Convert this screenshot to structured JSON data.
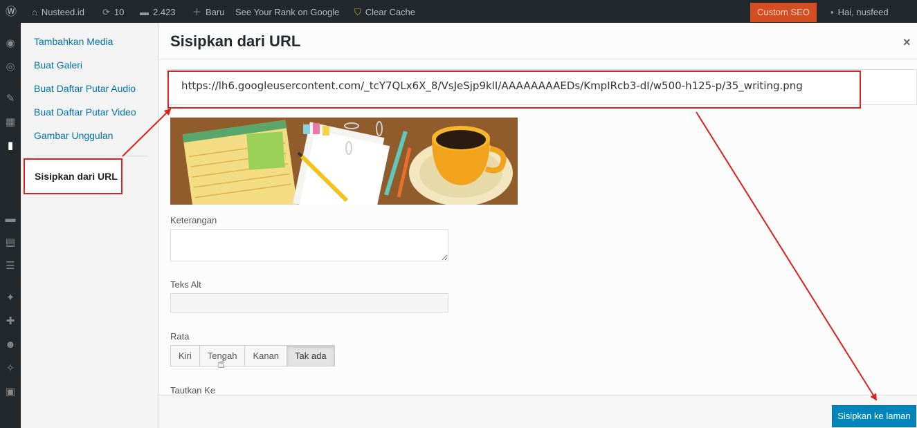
{
  "adminbar": {
    "site_name": "Nusteed.id",
    "updates_count": "10",
    "comments_count": "2.423",
    "new_label": "Baru",
    "rank_label": "See Your Rank on Google",
    "clear_cache_label": "Clear Cache",
    "seo_label": "Custom SEO",
    "greeting": "Hai, nusfeed"
  },
  "media_menu": {
    "items": [
      {
        "label": "Tambahkan Media"
      },
      {
        "label": "Buat Galeri"
      },
      {
        "label": "Buat Daftar Putar Audio"
      },
      {
        "label": "Buat Daftar Putar Video"
      },
      {
        "label": "Gambar Unggulan"
      }
    ],
    "active_item": "Sisipkan dari URL"
  },
  "frame": {
    "title": "Sisipkan dari URL",
    "close_icon": "×"
  },
  "url_field": {
    "value": "https://lh6.googleusercontent.com/_tcY7QLx6X_8/VsJeSjp9klI/AAAAAAAAEDs/KmpIRcb3-dI/w500-h125-p/35_writing.png"
  },
  "fields": {
    "caption_label": "Keterangan",
    "alt_label": "Teks Alt",
    "align_label": "Rata",
    "align_options": [
      "Kiri",
      "Tengah",
      "Kanan",
      "Tak ada"
    ],
    "link_label": "Tautkan Ke"
  },
  "toolbar": {
    "insert_label": "Sisipkan ke laman"
  },
  "colors": {
    "highlight": "#e0201c",
    "primary_button": "#0085ba",
    "link": "#0073aa"
  }
}
